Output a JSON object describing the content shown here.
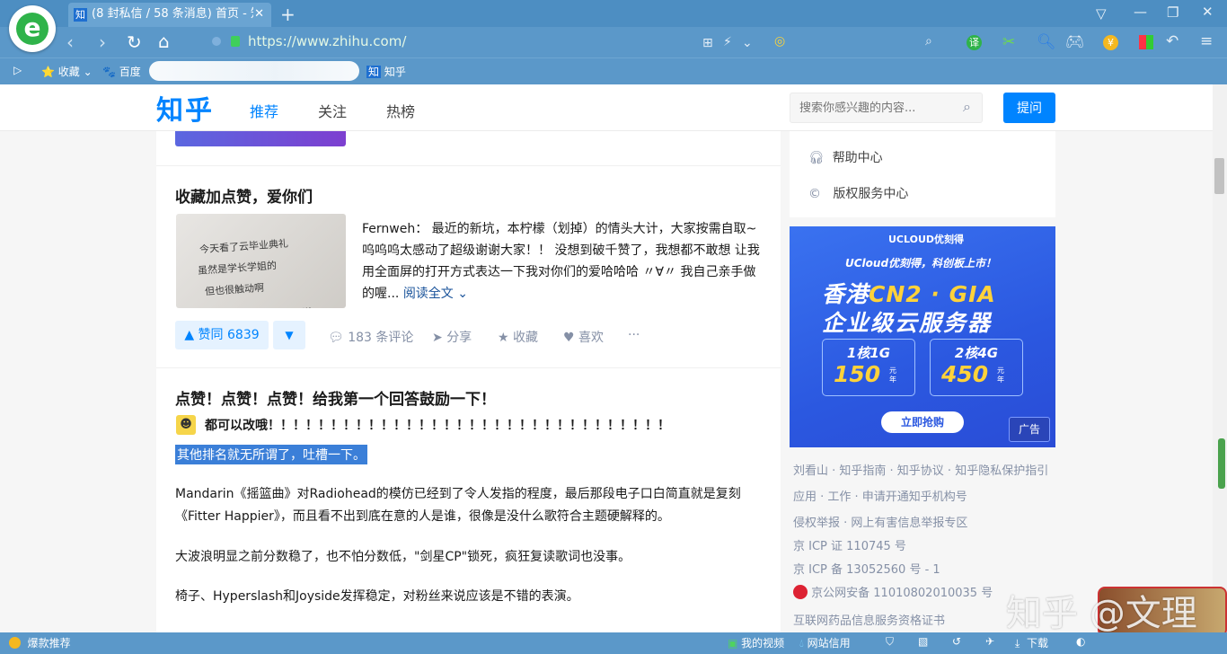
{
  "browser": {
    "tab_title": "(8 封私信 / 58 条消息) 首页 - 知",
    "tab_favicon": "知",
    "url": "https://www.zhihu.com/",
    "new_tab": "+",
    "close_tab": "✕",
    "bookmarks": [
      "收藏",
      "百度",
      "知乎"
    ]
  },
  "header": {
    "logo": "知乎",
    "nav": [
      "推荐",
      "关注",
      "热榜"
    ],
    "search_placeholder": "搜索你感兴趣的内容...",
    "ask_label": "提问"
  },
  "feed": [
    {
      "title": "收藏加点赞，爱你们",
      "photo_lines": [
        "今天看了云毕业典礼",
        "虽然是学长学姐的",
        "但也很触动啊",
        "..."
      ],
      "excerpt": "Fernweh： 最近的新坑，本柠檬（划掉）的情头大计，大家按需自取~ 呜呜呜太感动了超级谢谢大家！！ 没想到破千赞了，我想都不敢想 让我用全面屏的打开方式表达一下我对你们的爱哈哈哈 〃∀〃 我自己亲手做的喔...",
      "read_more": "阅读全文",
      "vote_label": "▲ 赞同 6839",
      "comments": "183 条评论",
      "share": "分享",
      "favorite": "收藏",
      "like": "喜欢",
      "more": "···"
    },
    {
      "title": "点赞！点赞！点赞！给我第一个回答鼓励一下！",
      "author_line": "都可以改哦！！！！！！！！！！！！！！！！！！！！！！！！！！！！！！！！",
      "highlight": "其他排名就无所谓了，吐槽一下。",
      "paragraphs": [
        "Mandarin《摇篮曲》对Radiohead的模仿已经到了令人发指的程度，最后那段电子口白简直就是复刻《Fitter Happier》，而且看不出到底在意的人是谁，很像是没什么歌符合主题硬解释的。",
        "大波浪明显之前分数稳了，也不怕分数低，\"剑星CP\"锁死，疯狂复读歌词也没事。",
        "椅子、Hyperslash和Joyside发挥稳定，对粉丝来说应该是不错的表演。"
      ]
    }
  ],
  "sidebar": {
    "links": [
      "帮助中心",
      "版权服务中心"
    ],
    "ad": {
      "brand": "UCLOUD优刻得",
      "subtitle": "UCloud优刻得，科创板上市！",
      "headline1a": "香港",
      "headline1b": "CN2 · GIA",
      "headline2": "企业级云服务器",
      "plans": [
        {
          "spec": "1核1G",
          "price": "150",
          "unit": "元\n年"
        },
        {
          "spec": "2核4G",
          "price": "450",
          "unit": "元\n年"
        }
      ],
      "cta": "立即抢购",
      "tag": "广告"
    },
    "footer": [
      "刘看山 · 知乎指南 · 知乎协议 · 知乎隐私保护指引",
      "应用 · 工作 · 申请开通知乎机构号",
      "侵权举报 · 网上有害信息举报专区",
      "京 ICP 证 110745 号",
      "京 ICP 备 13052560 号 - 1",
      "京公网安备 11010802010035 号",
      "互联网药品信息服务资格证书"
    ]
  },
  "watermark": "知乎 @文理",
  "statusbar": {
    "left": "爆款推荐",
    "items": [
      "我的视频",
      "网站信用",
      "下载"
    ]
  }
}
